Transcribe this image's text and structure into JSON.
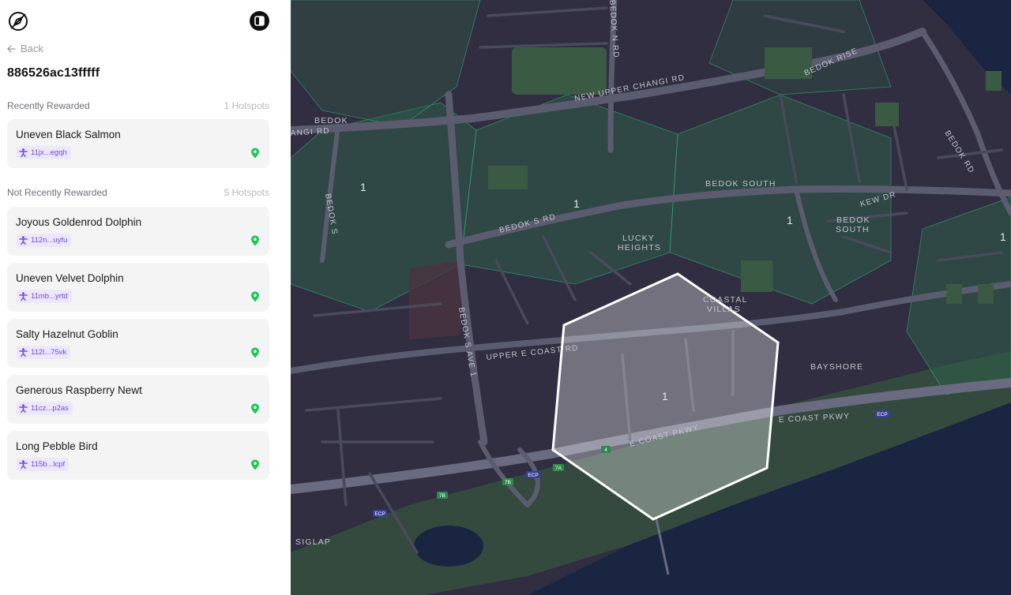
{
  "sidebar": {
    "back_label": "Back",
    "hex_id": "886526ac13fffff",
    "recent": {
      "title": "Recently Rewarded",
      "count": "1 Hotspots",
      "items": [
        {
          "name": "Uneven Black Salmon",
          "address": "11jx...egqh"
        }
      ]
    },
    "not_recent": {
      "title": "Not Recently Rewarded",
      "count": "5 Hotspots",
      "items": [
        {
          "name": "Joyous Goldenrod Dolphin",
          "address": "112n...uyfu"
        },
        {
          "name": "Uneven Velvet Dolphin",
          "address": "11mb...yrtd"
        },
        {
          "name": "Salty Hazelnut Goblin",
          "address": "112l...75vk"
        },
        {
          "name": "Generous Raspberry Newt",
          "address": "11cz...p2as"
        },
        {
          "name": "Long Pebble Bird",
          "address": "115b...lcpf"
        }
      ]
    }
  },
  "map": {
    "road_labels": {
      "new_upper_changi": "NEW UPPER CHANGI RD",
      "bedok_s_rd": "BEDOK S RD",
      "bedok_s_ave_1": "BEDOK S AVE 1",
      "bedok_s": "BEDOK S",
      "upper_e_coast": "UPPER E COAST RD",
      "e_coast_pkwy_1": "E COAST PKWY",
      "e_coast_pkwy_2": "E COAST PKWY",
      "bedok_rise": "BEDOK RISE",
      "bedok_rd": "BEDOK RD",
      "kew_dr": "KEW DR",
      "bedok_n_rd": "BEDOK N RD",
      "angi_rd": "ANGI RD"
    },
    "place_labels": {
      "bedok": "BEDOK",
      "bedok_south": "BEDOK SOUTH",
      "bedok_south_2a": "BEDOK",
      "bedok_south_2b": "SOUTH",
      "lucky_1": "LUCKY",
      "lucky_2": "HEIGHTS",
      "coastal_1": "COASTAL",
      "coastal_2": "VILLAS",
      "bayshore": "BAYSHORE",
      "siglap": "SIGLAP"
    },
    "hex_counts": {
      "a": "1",
      "b": "1",
      "c": "1",
      "d": "1",
      "selected": "1"
    },
    "shields": {
      "ecp_1": "ECP",
      "ecp_2": "ECP",
      "ecp_3": "ECP",
      "s7b_1": "7B",
      "s7b_2": "7B",
      "s7a": "7A",
      "s4": "4"
    },
    "colors": {
      "land": "#302e40",
      "water": "#1a2542",
      "hex_fill": "#2f5f48",
      "selected_hex": "#ffffff",
      "hotspot_pin": "#22c55e",
      "address_accent": "#6d4ae0"
    }
  }
}
